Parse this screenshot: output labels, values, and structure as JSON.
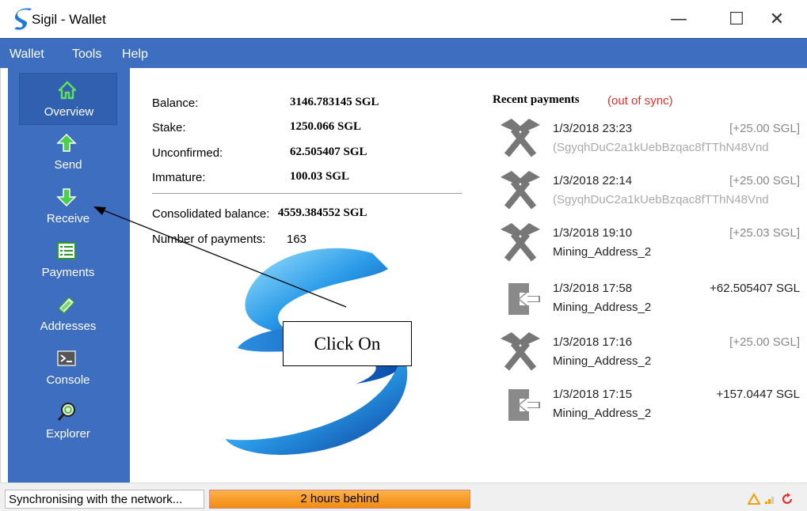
{
  "window": {
    "title": "Sigil - Wallet",
    "minimize": "—",
    "maximize": "☐",
    "close": "✕"
  },
  "menu": [
    "Wallet",
    "Tools",
    "Help"
  ],
  "sidebar": {
    "items": [
      {
        "label": "Overview",
        "icon": "home-icon"
      },
      {
        "label": "Send",
        "icon": "arrow-up-icon"
      },
      {
        "label": "Receive",
        "icon": "arrow-down-icon"
      },
      {
        "label": "Payments",
        "icon": "list-icon"
      },
      {
        "label": "Addresses",
        "icon": "address-book-icon"
      },
      {
        "label": "Console",
        "icon": "console-icon"
      },
      {
        "label": "Explorer",
        "icon": "magnifier-icon"
      }
    ],
    "active": "Overview"
  },
  "overview": {
    "balance_label": "Balance:",
    "balance_value": "3146.783145 SGL",
    "stake_label": "Stake:",
    "stake_value": "1250.066 SGL",
    "unconfirmed_label": "Unconfirmed:",
    "unconfirmed_value": "62.505407 SGL",
    "immature_label": "Immature:",
    "immature_value": "100.03 SGL",
    "consolidated_label": "Consolidated balance:",
    "consolidated_value": "4559.384552 SGL",
    "payments_label": "Number of payments:",
    "payments_value": "163"
  },
  "recent": {
    "title": "Recent payments",
    "sync_status": "(out of sync)",
    "items": [
      {
        "type": "mined",
        "date": "1/3/2018 23:23",
        "amount": "[+25.00 SGL]",
        "sub": "(SgyqhDuC2a1kUebBzqac8fTThN48Vnd",
        "sub_grey": true,
        "confirmed": false
      },
      {
        "type": "mined",
        "date": "1/3/2018 22:14",
        "amount": "[+25.00 SGL]",
        "sub": "(SgyqhDuC2a1kUebBzqac8fTThN48Vnd",
        "sub_grey": true,
        "confirmed": false
      },
      {
        "type": "mined",
        "date": "1/3/2018 19:10",
        "amount": "[+25.03 SGL]",
        "sub": "Mining_Address_2",
        "sub_grey": false,
        "confirmed": false
      },
      {
        "type": "received",
        "date": "1/3/2018 17:58",
        "amount": "+62.505407 SGL",
        "sub": "Mining_Address_2",
        "sub_grey": false,
        "confirmed": true
      },
      {
        "type": "mined",
        "date": "1/3/2018 17:16",
        "amount": "[+25.00 SGL]",
        "sub": "Mining_Address_2",
        "sub_grey": false,
        "confirmed": false
      },
      {
        "type": "received",
        "date": "1/3/2018 17:15",
        "amount": "+157.0447 SGL",
        "sub": "Mining_Address_2",
        "sub_grey": false,
        "confirmed": true
      }
    ]
  },
  "callout": {
    "text": "Click On"
  },
  "status": {
    "text": "Synchronising with the network...",
    "progress": "2 hours behind"
  }
}
